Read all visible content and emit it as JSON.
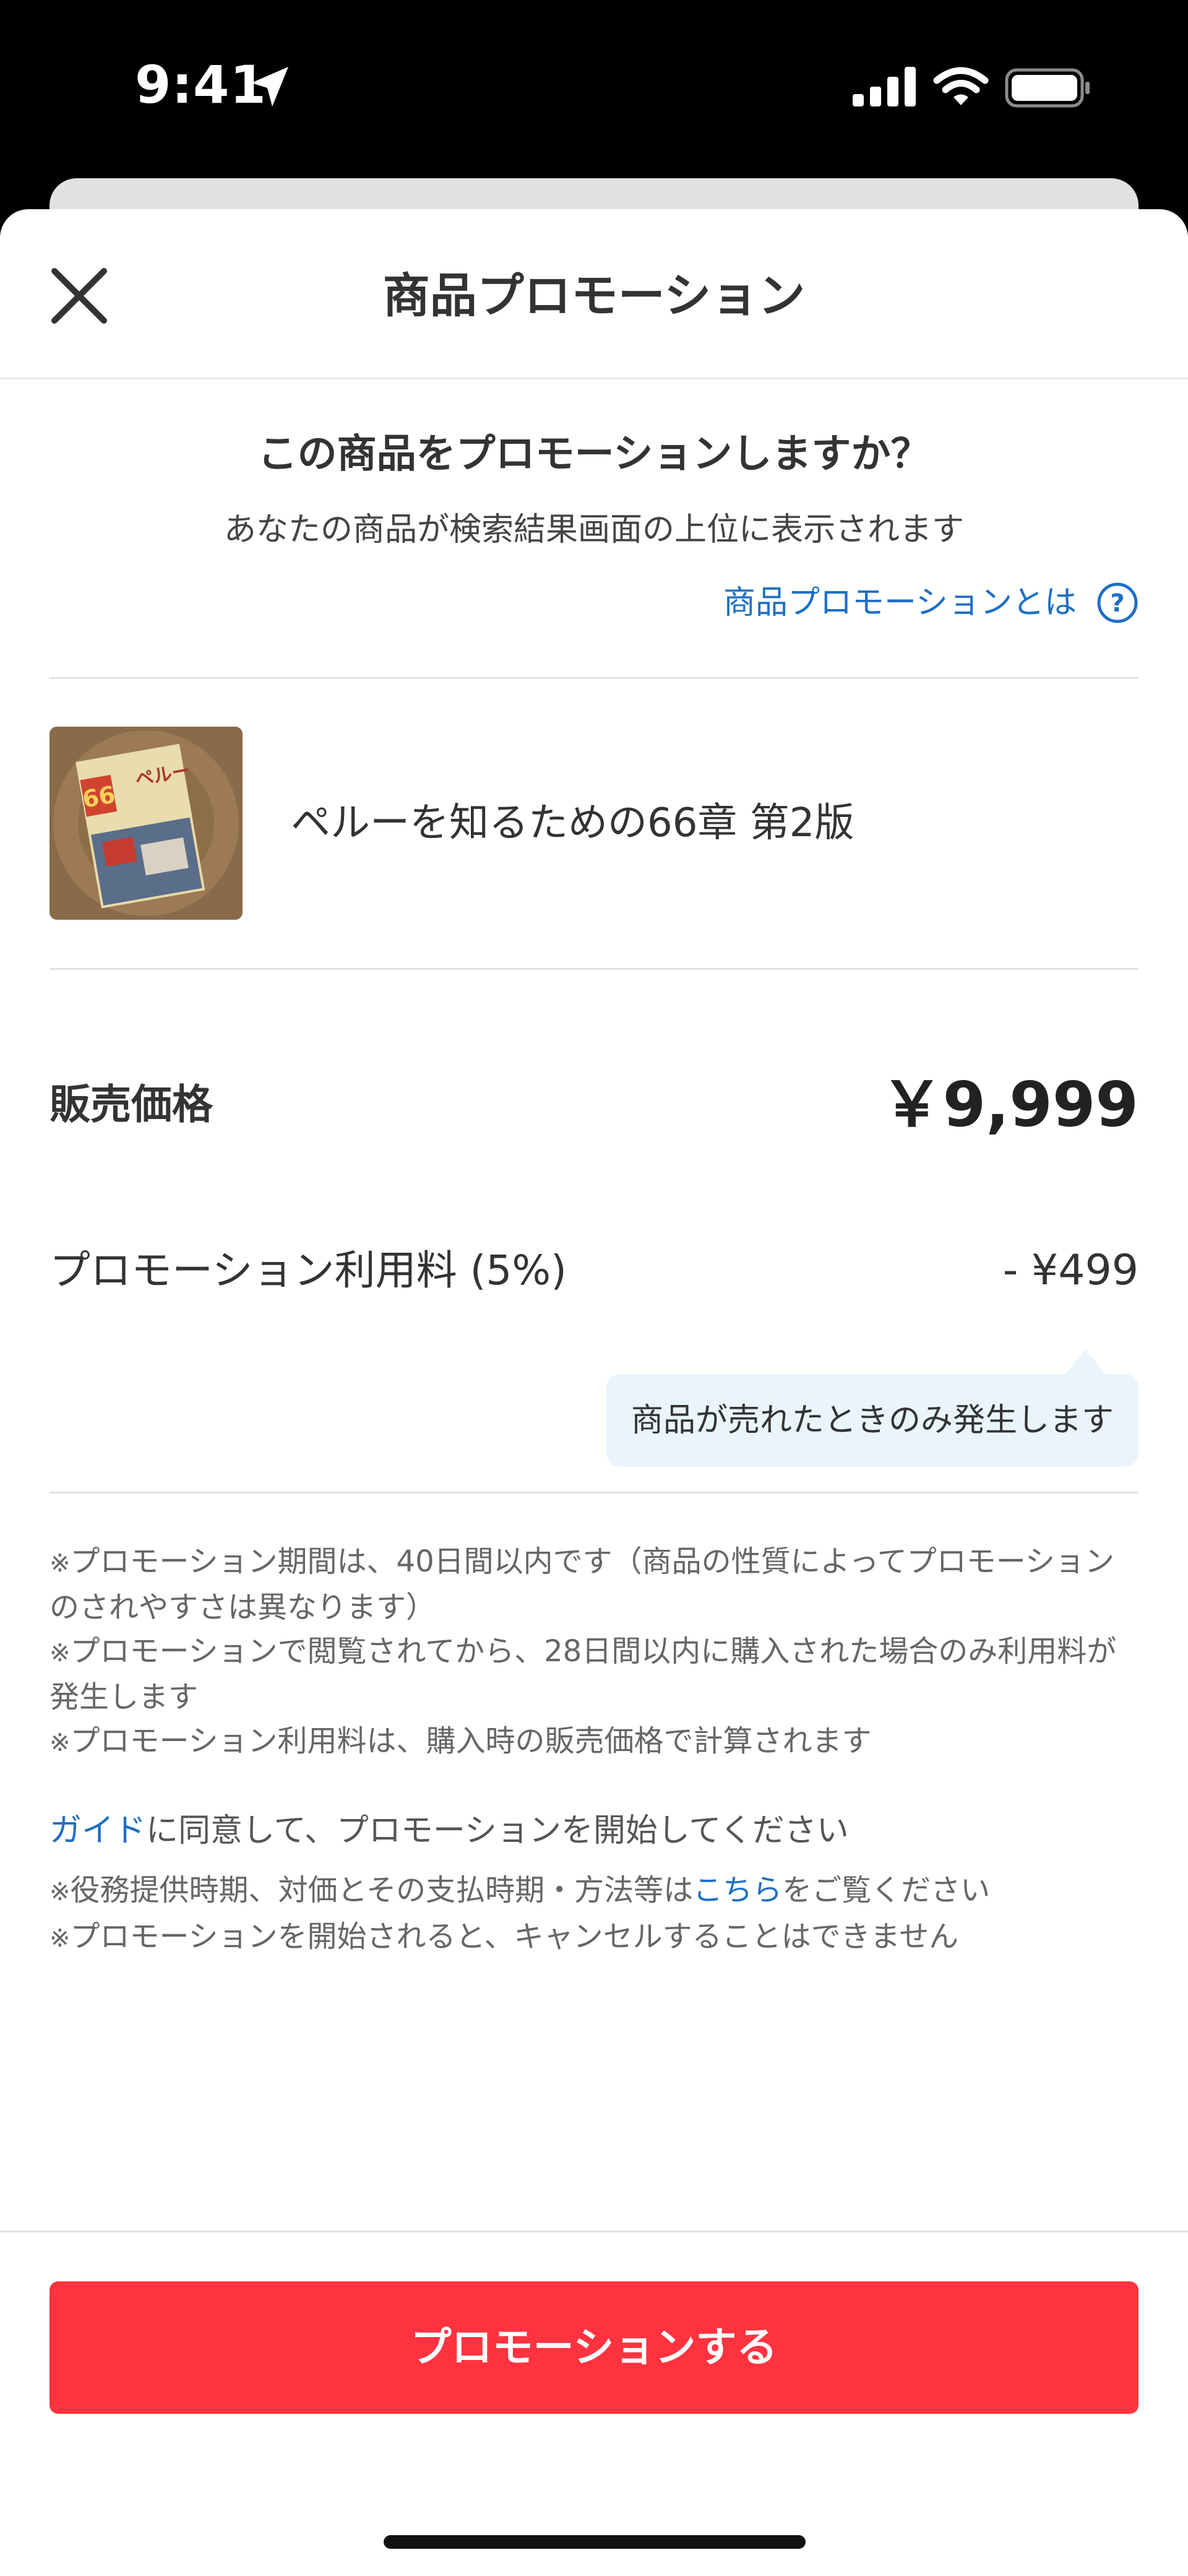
{
  "status_bar": {
    "time": "9:41"
  },
  "header": {
    "title": "商品プロモーション"
  },
  "promo": {
    "question": "この商品をプロモーションしますか？",
    "subtitle": "あなたの商品が検索結果画面の上位に表示されます",
    "about_link": "商品プロモーションとは",
    "help_icon": "?"
  },
  "item": {
    "name": "ペルーを知るための66章 第2版",
    "thumbnail": {
      "cover_number": "66",
      "cover_title": "ペルー"
    }
  },
  "pricing": {
    "price_label": "販売価格",
    "price_value": "￥9,999",
    "fee_label": "プロモーション利用料 (5%)",
    "fee_value": "- ¥499",
    "fee_tooltip": "商品が売れたときのみ発生します"
  },
  "notes": [
    {
      "mark": "※",
      "text": "プロモーション期間は、40日間以内です（商品の性質によってプロモーションのされやすさは異なります）"
    },
    {
      "mark": "※",
      "text": "プロモーションで閲覧されてから、28日間以内に購入された場合のみ利用料が発生します"
    },
    {
      "mark": "※",
      "text": "プロモーション利用料は、購入時の販売価格で計算されます"
    }
  ],
  "agreement": {
    "guide_link": "ガイド",
    "text": "に同意して、プロモーションを開始してください"
  },
  "terms": [
    {
      "mark": "※",
      "before": "役務提供時期、対価とその支払時期・方法等は",
      "link": "こちら",
      "after": "をご覧ください"
    },
    {
      "mark": "※",
      "text": "プロモーションを開始されると、キャンセルすることはできません"
    }
  ],
  "cta": {
    "label": "プロモーションする"
  },
  "colors": {
    "accent_red": "#ff333f",
    "link_blue": "#1f6fc5",
    "tooltip_bg": "#e9f5fb"
  }
}
